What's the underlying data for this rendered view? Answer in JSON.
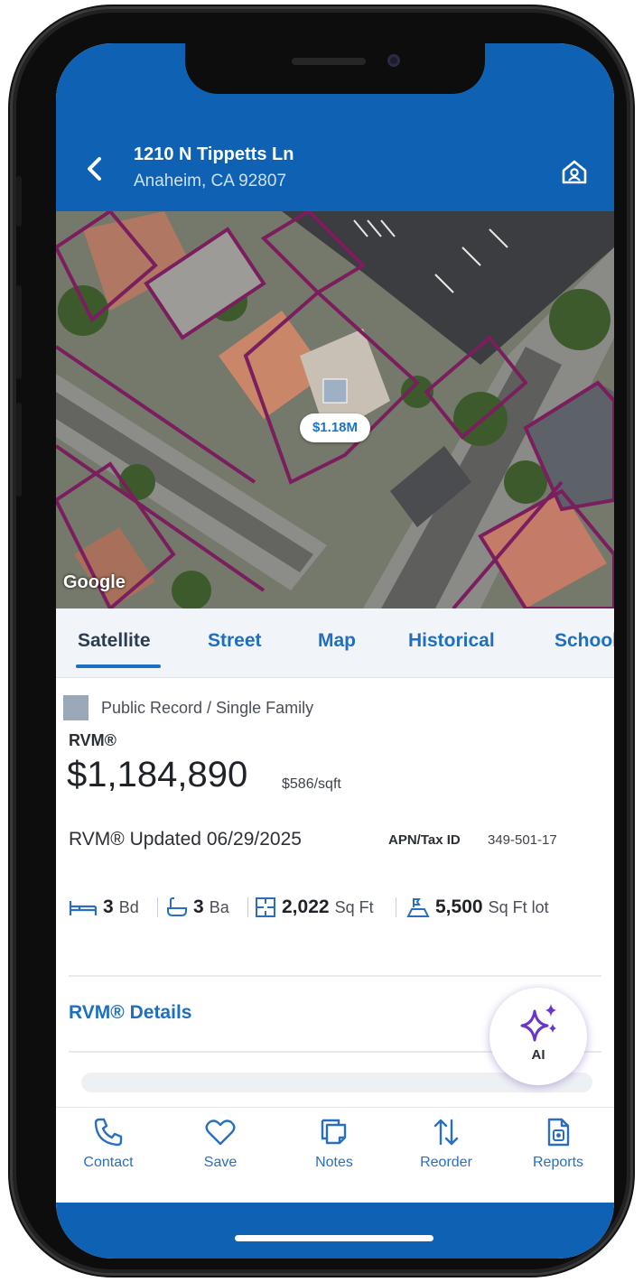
{
  "header": {
    "back_icon": "chevron-left-icon",
    "address_line1": "1210 N Tippetts Ln",
    "address_line2": "Anaheim, CA 92807",
    "home_icon": "home-icon"
  },
  "map": {
    "price_pill": "$1.18M",
    "attribution": "Google"
  },
  "tabs": [
    {
      "label": "Satellite",
      "active": true
    },
    {
      "label": "Street",
      "active": false
    },
    {
      "label": "Map",
      "active": false
    },
    {
      "label": "Historical",
      "active": false
    },
    {
      "label": "Schools",
      "active": false
    }
  ],
  "property": {
    "record_type": "Public Record / Single Family",
    "rvm_label": "RVM®",
    "rvm_value": "$1,184,890",
    "price_per_sqft": "$586/sqft",
    "rvm_updated": "RVM® Updated 06/29/2025",
    "apn_label": "APN/Tax ID",
    "apn_value": "349-501-17",
    "facts": [
      {
        "icon": "bed-icon",
        "value": "3",
        "unit": "Bd"
      },
      {
        "icon": "bath-icon",
        "value": "3",
        "unit": "Ba"
      },
      {
        "icon": "floorplan-icon",
        "value": "2,022",
        "unit": "Sq Ft"
      },
      {
        "icon": "lot-icon",
        "value": "5,500",
        "unit": "Sq Ft lot"
      }
    ],
    "details_link": "RVM® Details"
  },
  "ai_fab": {
    "icon": "sparkle-icon",
    "label": "AI"
  },
  "bottom_nav": [
    {
      "icon": "phone-icon",
      "label": "Contact"
    },
    {
      "icon": "heart-icon",
      "label": "Save"
    },
    {
      "icon": "notes-icon",
      "label": "Notes"
    },
    {
      "icon": "reorder-icon",
      "label": "Reorder"
    },
    {
      "icon": "reports-icon",
      "label": "Reports"
    }
  ],
  "colors": {
    "brand_blue": "#0f62b3",
    "link_blue": "#1f6fc0",
    "parcel_outline": "#7b1e5e",
    "ai_purple": "#6a35c8"
  }
}
